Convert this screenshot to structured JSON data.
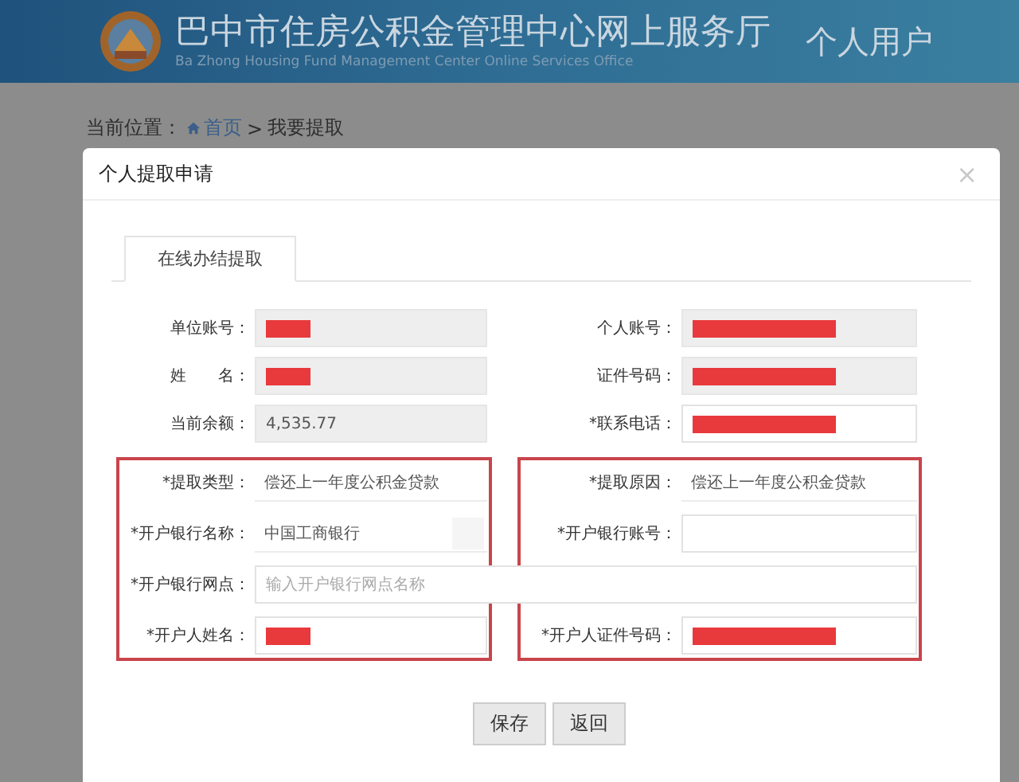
{
  "header": {
    "title": "巴中市住房公积金管理中心网上服务厅",
    "subtitle": "Ba Zhong Housing Fund Management Center Online Services Office",
    "user_area": "个人用户"
  },
  "breadcrumb": {
    "label": "当前位置：",
    "separator": ">",
    "items": [
      {
        "text": "首页",
        "kind": "home"
      },
      {
        "text": "我要提取",
        "kind": "current"
      }
    ]
  },
  "dialog": {
    "title": "个人提取申请",
    "close": "×",
    "tabs": [
      {
        "label": "在线办结提取",
        "selected": true
      }
    ],
    "info": {
      "left": [
        {
          "label": "单位账号：",
          "kind": "readonly",
          "redacted": true
        },
        {
          "label": "姓　　名：",
          "kind": "readonly",
          "redacted": true
        },
        {
          "label": "当前余额：",
          "kind": "readonly",
          "value": "4,535.77"
        }
      ],
      "right": [
        {
          "label": "个人账号：",
          "kind": "readonly",
          "redacted": true
        },
        {
          "label": "证件号码：",
          "kind": "readonly",
          "redacted": true
        },
        {
          "label": "*联系电话：",
          "kind": "input",
          "redacted": true
        }
      ]
    },
    "highlighted": {
      "left": [
        {
          "label": "*提取类型：",
          "kind": "select",
          "value": "偿还上一年度公积金贷款"
        },
        {
          "label": "*开户银行名称：",
          "kind": "dropdown",
          "value": "中国工商银行"
        },
        {
          "label": "*开户银行网点：",
          "kind": "wide",
          "placeholder": "输入开户银行网点名称"
        },
        {
          "label": "*开户人姓名：",
          "kind": "input",
          "redacted": true
        }
      ],
      "right": [
        {
          "label": "*提取原因：",
          "kind": "select",
          "value": "偿还上一年度公积金贷款"
        },
        {
          "label": "*开户银行账号：",
          "kind": "input"
        },
        {
          "label": "*开户人证件号码：",
          "kind": "input",
          "redacted": true
        }
      ]
    },
    "buttons": [
      "保存",
      "返回"
    ]
  }
}
